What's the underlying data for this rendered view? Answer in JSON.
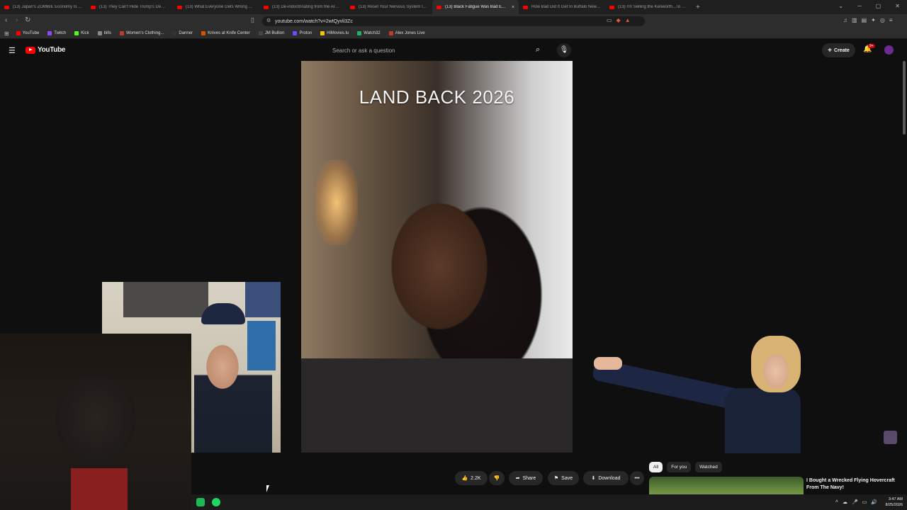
{
  "browser": {
    "tabs": [
      {
        "title": "(13) Japan's ZOMBIE Economy Is Ab..."
      },
      {
        "title": "(13) They Can't Hide Trump's Demen..."
      },
      {
        "title": "(13) What Everyone Gets Wrong Abo..."
      },
      {
        "title": "(13) De-indoctrinating from the Arba..."
      },
      {
        "title": "(13) Reset Your Nervous System In 3..."
      },
      {
        "title": "(13) Black Fatigue Was Bad E...",
        "active": true
      },
      {
        "title": "How Bad Did It Get In Buffalo New Y..."
      },
      {
        "title": "(13) I'm Selling the Kenworth...To Bu..."
      }
    ],
    "new_tab": "+",
    "tab_close": "×",
    "url": "youtube.com/watch?v=2wtQyvli3Zc",
    "bookmarks": [
      {
        "label": "YouTube",
        "color": "#ff0000"
      },
      {
        "label": "Twitch",
        "color": "#9146ff"
      },
      {
        "label": "Kick",
        "color": "#53fc18"
      },
      {
        "label": "bills",
        "color": "#888888"
      },
      {
        "label": "Women's Clothing...",
        "color": "#c0392b"
      },
      {
        "label": "Danner",
        "color": "#333333"
      },
      {
        "label": "Knives at Knife Center",
        "color": "#d35400"
      },
      {
        "label": "JM Bullion",
        "color": "#444444"
      },
      {
        "label": "Proton",
        "color": "#6d4aff"
      },
      {
        "label": "HiMovies.lu",
        "color": "#f1c40f"
      },
      {
        "label": "Watch32",
        "color": "#27ae60"
      },
      {
        "label": "Alex Jones Live",
        "color": "#c0392b"
      }
    ]
  },
  "youtube": {
    "logo_text": "YouTube",
    "search_placeholder": "Search or ask a question",
    "create_label": "Create",
    "notifications_badge": "9+",
    "video_overlay_text": "LAND BACK 2026",
    "actions": {
      "likes": "2.2K",
      "share": "Share",
      "save": "Save",
      "download": "Download",
      "more": "•••"
    },
    "chips": [
      "All",
      "For you",
      "Watched"
    ],
    "recommended_title": "I Bought a Wrecked Flying Hovercraft From The Navy!"
  },
  "taskbar": {
    "time": "3:47 AM",
    "date": "8/25/2026"
  },
  "icons": {
    "back": "back-arrow-icon",
    "forward": "forward-arrow-icon",
    "reload": "reload-icon",
    "menu": "hamburger-icon",
    "search": "search-icon",
    "mic": "mic-icon",
    "bell": "bell-icon"
  }
}
